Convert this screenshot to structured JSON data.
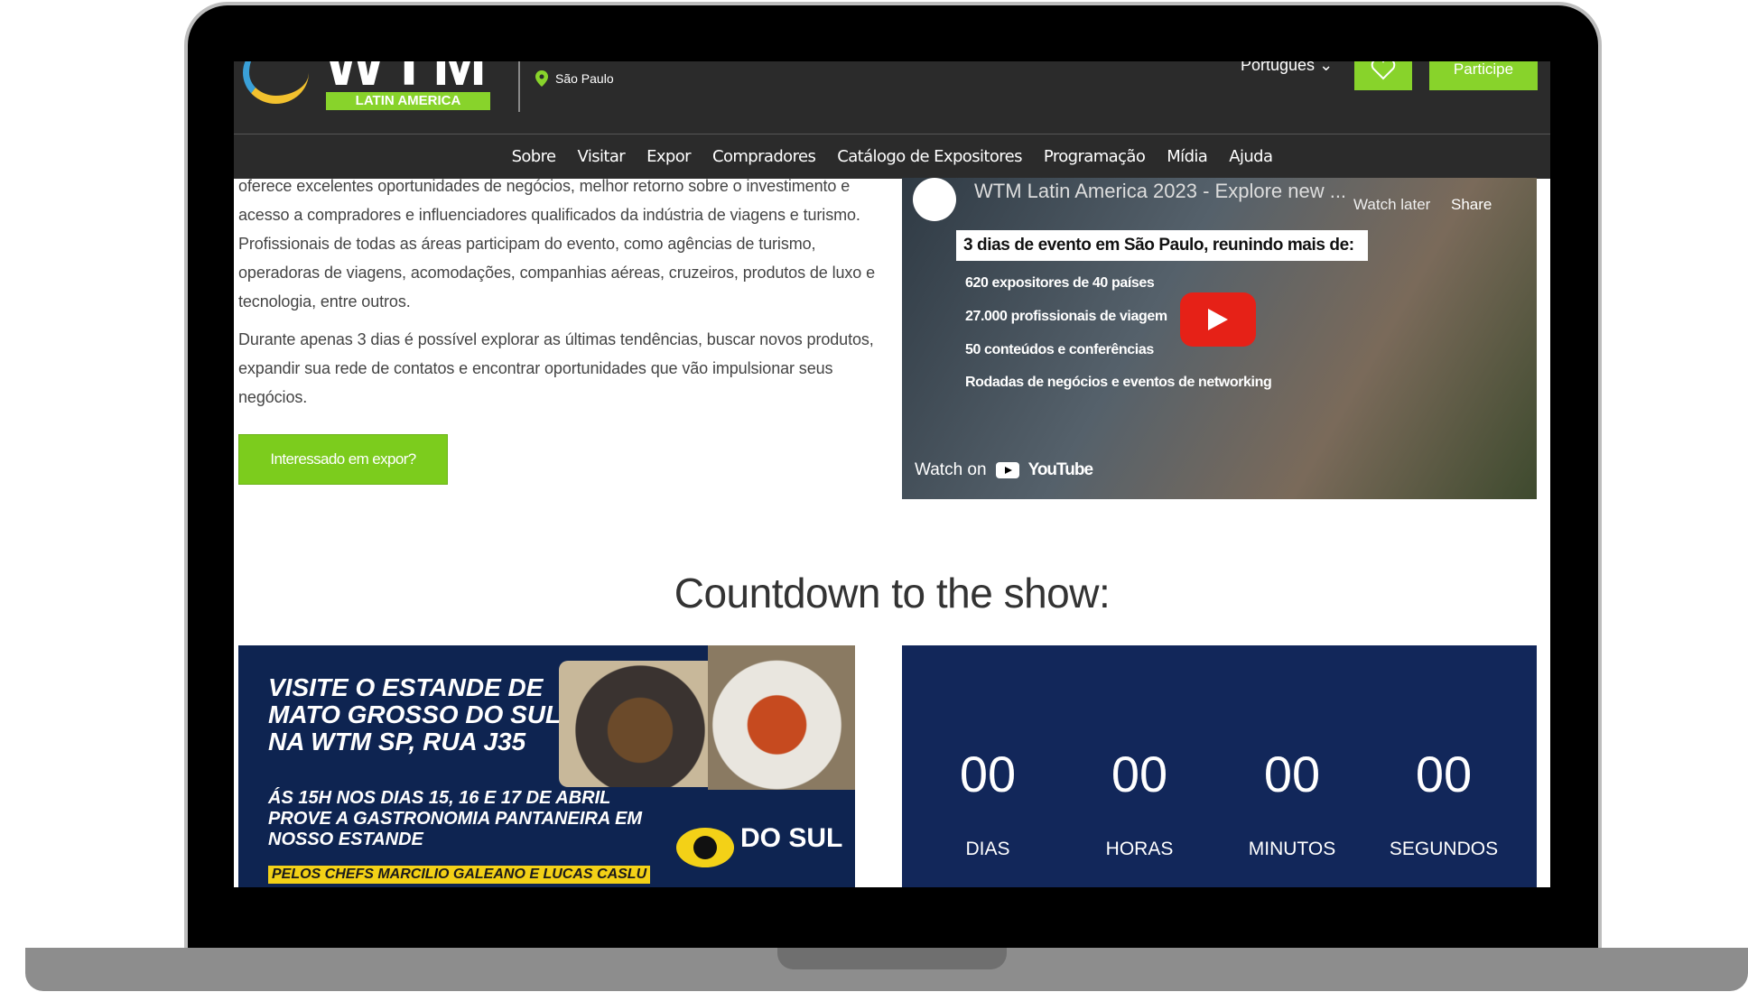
{
  "header": {
    "logo_text": "WTM",
    "logo_sub": "LATIN AMERICA",
    "city": "São Paulo",
    "language": "Portugues",
    "cta": "Participe",
    "nav": [
      "Sobre",
      "Visitar",
      "Expor",
      "Compradores",
      "Catálogo de Expositores",
      "Programação",
      "Mídia",
      "Ajuda"
    ]
  },
  "intro": {
    "paragraph1": "oferece excelentes oportunidades de negócios, melhor retorno sobre o investimento e acesso a compradores e influenciadores qualificados da indústria de viagens e turismo. Profissionais de todas as áreas participam do evento, como agências de turismo, operadoras de viagens, acomodações, companhias aéreas, cruzeiros, produtos de luxo e tecnologia, entre outros.",
    "paragraph2": "Durante apenas 3 dias é possível explorar as últimas tendências, buscar novos produtos, expandir sua rede de contatos e encontrar oportunidades que vão impulsionar seus negócios.",
    "button": "Interessado em expor?"
  },
  "video": {
    "title": "WTM Latin America 2023 - Explore new ...",
    "watch_later": "Watch later",
    "share": "Share",
    "headline": "3 dias de evento em São Paulo, reunindo mais de:",
    "stats": [
      "620 expositores de 40 países",
      "27.000 profissionais de viagem",
      "50 conteúdos e conferências",
      "Rodadas de negócios e eventos de networking"
    ],
    "watch_on": "Watch on",
    "youtube": "YouTube"
  },
  "countdown": {
    "title": "Countdown to the show:",
    "units": [
      {
        "value": "00",
        "label": "DIAS"
      },
      {
        "value": "00",
        "label": "HORAS"
      },
      {
        "value": "00",
        "label": "MINUTOS"
      },
      {
        "value": "00",
        "label": "SEGUNDOS"
      }
    ]
  },
  "ad": {
    "line1": "VISITE O ESTANDE DE MATO GROSSO DO SUL NA WTM SP, RUA J35",
    "line2": "ÁS 15H NOS DIAS 15, 16 E 17 DE ABRIL PROVE A GASTRONOMIA PANTANEIRA EM NOSSO ESTANDE",
    "chefs": "PELOS CHEFS MARCILIO GALEANO E LUCAS CASLU",
    "brand": "DO SUL"
  }
}
